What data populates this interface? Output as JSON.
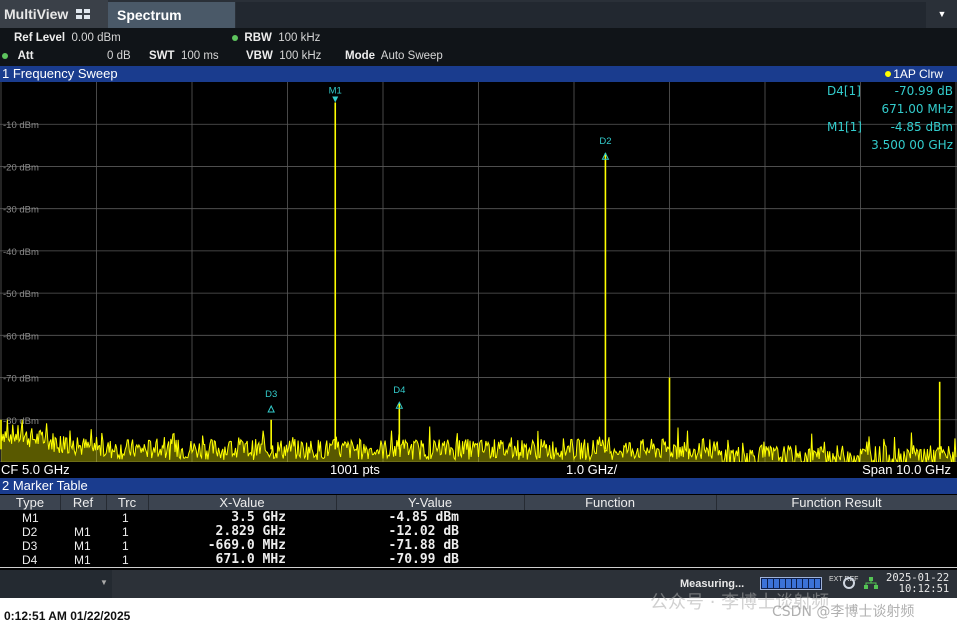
{
  "tabs": {
    "multiview": "MultiView",
    "spectrum": "Spectrum"
  },
  "settings": {
    "ref_level_label": "Ref Level",
    "ref_level_value": "0.00 dBm",
    "att_label": "Att",
    "att_value": "0 dB",
    "swt_label": "SWT",
    "swt_value": "100 ms",
    "rbw_label": "RBW",
    "rbw_value": "100 kHz",
    "vbw_label": "VBW",
    "vbw_value": "100 kHz",
    "mode_label": "Mode",
    "mode_value": "Auto Sweep"
  },
  "sweep": {
    "title": "1 Frequency Sweep",
    "trace_label": "1AP Clrw"
  },
  "marker_info": [
    {
      "label": "D4[1]",
      "value": "-70.99 dB"
    },
    {
      "label": "",
      "value": "671.00 MHz"
    },
    {
      "label": "M1[1]",
      "value": "-4.85 dBm"
    },
    {
      "label": "",
      "value": "3.500 00 GHz"
    }
  ],
  "chart_data": {
    "type": "line",
    "xlabel": "",
    "ylabel": "",
    "ylim": [
      -90,
      0
    ],
    "y_ticks": [
      "-10 dBm",
      "-20 dBm",
      "-30 dBm",
      "-40 dBm",
      "-50 dBm",
      "-60 dBm",
      "-70 dBm",
      "-80 dBm"
    ],
    "xlim_ghz": [
      0,
      10
    ],
    "grid": true,
    "trace_color": "#ffff00",
    "noise_floor_dbm": -87,
    "peaks": [
      {
        "f_ghz": 0.0,
        "level_dbm": -80
      },
      {
        "f_ghz": 2.829,
        "level_dbm": -80
      },
      {
        "f_ghz": 3.5,
        "level_dbm": -4.85
      },
      {
        "f_ghz": 4.171,
        "level_dbm": -76
      },
      {
        "f_ghz": 6.329,
        "level_dbm": -16.87
      },
      {
        "f_ghz": 7.0,
        "level_dbm": -70
      },
      {
        "f_ghz": 9.829,
        "level_dbm": -71
      }
    ],
    "markers": [
      {
        "name": "M1",
        "f_ghz": 3.5,
        "level_dbm": -4.85
      },
      {
        "name": "D2",
        "f_ghz": 6.329,
        "level_dbm": -16.87
      },
      {
        "name": "D3",
        "f_ghz": 2.829,
        "level_dbm": -76.73
      },
      {
        "name": "D4",
        "f_ghz": 4.171,
        "level_dbm": -75.84
      }
    ]
  },
  "statusbar": {
    "cf": "CF 5.0 GHz",
    "pts": "1001 pts",
    "div": "1.0 GHz/",
    "span": "Span 10.0 GHz"
  },
  "marker_table": {
    "title": "2 Marker Table",
    "headers": [
      "Type",
      "Ref",
      "Trc",
      "X-Value",
      "Y-Value",
      "Function",
      "Function Result"
    ],
    "rows": [
      {
        "type": "M1",
        "ref": "",
        "trc": "1",
        "x": "3.5 GHz",
        "y": "-4.85 dBm"
      },
      {
        "type": "D2",
        "ref": "M1",
        "trc": "1",
        "x": "2.829 GHz",
        "y": "-12.02 dB"
      },
      {
        "type": "D3",
        "ref": "M1",
        "trc": "1",
        "x": "-669.0 MHz",
        "y": "-71.88 dB"
      },
      {
        "type": "D4",
        "ref": "M1",
        "trc": "1",
        "x": "671.0 MHz",
        "y": "-70.99 dB"
      }
    ]
  },
  "footer": {
    "measuring": "Measuring...",
    "ext_ref": "EXT REF",
    "date": "2025-01-22",
    "time": "10:12:51"
  },
  "bottom_timestamp": "0:12:51 AM  01/22/2025",
  "watermark": {
    "text1": "公众号 · 李博士谈射频",
    "text2": "CSDN @李博士谈射频"
  },
  "colors": {
    "title_bar": "#1a3c8e",
    "trace": "#ffff00",
    "marker": "#33cccc",
    "grid": "#5a5a5a"
  }
}
